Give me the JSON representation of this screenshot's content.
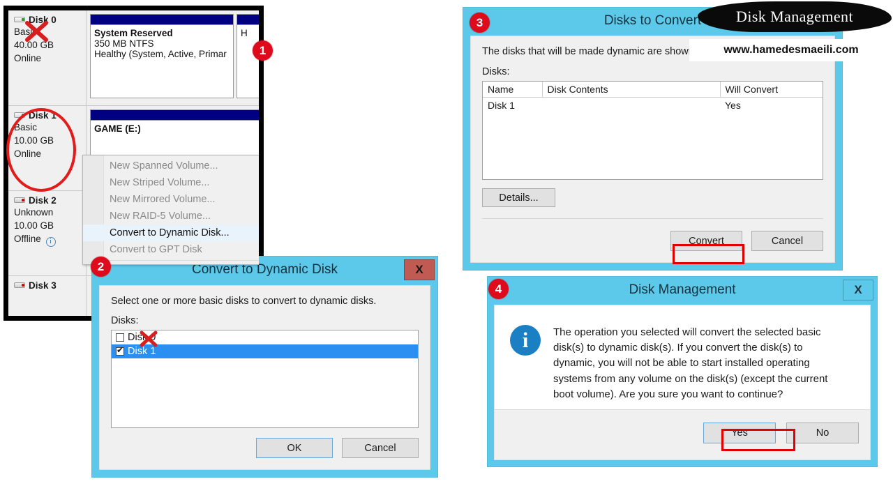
{
  "brand": {
    "banner_title": "Disk Management",
    "url": "www.hamedesmaeili.com"
  },
  "badges": {
    "one": "1",
    "two": "2",
    "three": "3",
    "four": "4"
  },
  "disk_management_console": {
    "disks": [
      {
        "name": "Disk 0",
        "type": "Basic",
        "size": "40.00 GB",
        "status": "Online",
        "icon": "hard-disk-icon",
        "volumes": [
          {
            "name": "System Reserved",
            "line1": "350 MB NTFS",
            "line2": "Healthy (System, Active, Primar"
          },
          {
            "name": "",
            "line1": "",
            "line2": "H"
          }
        ]
      },
      {
        "name": "Disk 1",
        "type": "Basic",
        "size": "10.00 GB",
        "status": "Online",
        "icon": "hard-disk-icon",
        "volumes": [
          {
            "name": "GAME  (E:)",
            "line1": "",
            "line2": ""
          }
        ]
      },
      {
        "name": "Disk 2",
        "type": "Unknown",
        "size": "10.00 GB",
        "status": "Offline",
        "status_icon": "info-icon",
        "icon": "offline-disk-icon",
        "volumes": []
      },
      {
        "name": "Disk 3",
        "type": "",
        "size": "",
        "status": "",
        "icon": "offline-disk-icon",
        "volumes": []
      }
    ],
    "context_menu": {
      "items": [
        {
          "label": "New Spanned Volume...",
          "enabled": false,
          "selected": false
        },
        {
          "label": "New Striped Volume...",
          "enabled": false,
          "selected": false
        },
        {
          "label": "New Mirrored Volume...",
          "enabled": false,
          "selected": false
        },
        {
          "label": "New RAID-5 Volume...",
          "enabled": false,
          "selected": false
        },
        {
          "label": "Convert to Dynamic Disk...",
          "enabled": true,
          "selected": true,
          "highlighted": true
        },
        {
          "label": "Convert to GPT Disk",
          "enabled": false,
          "selected": false
        }
      ]
    }
  },
  "convert_dialog": {
    "title": "Convert to Dynamic Disk",
    "close_label": "X",
    "instruction": "Select one or more basic disks to convert to dynamic disks.",
    "list_label": "Disks:",
    "disks": [
      {
        "label": "Disk 0",
        "checked": false,
        "selected": false
      },
      {
        "label": "Disk 1",
        "checked": true,
        "selected": true
      }
    ],
    "ok_label": "OK",
    "cancel_label": "Cancel"
  },
  "disks_to_convert_dialog": {
    "title": "Disks to Convert",
    "instruction": "The disks that will be made dynamic are shown in the foll",
    "list_label": "Disks:",
    "columns": [
      "Name",
      "Disk Contents",
      "Will Convert"
    ],
    "rows": [
      {
        "name": "Disk 1",
        "contents": "",
        "will_convert": "Yes"
      }
    ],
    "details_label": "Details...",
    "convert_label": "Convert",
    "cancel_label": "Cancel"
  },
  "confirm_dialog": {
    "title": "Disk Management",
    "close_label": "X",
    "icon": "info-icon",
    "message": "The operation you selected will convert the selected basic disk(s) to dynamic disk(s). If you convert the disk(s) to dynamic, you will not be able to start installed operating systems from any volume on the disk(s) (except the current boot volume). Are you sure you want to continue?",
    "yes_label": "Yes",
    "no_label": "No"
  },
  "colors": {
    "teal": "#5cc9ea",
    "accent_red": "#e00000",
    "badge_red": "#dd0b1b",
    "selection_blue": "#2a8ff0",
    "volume_bar_blue": "#000080"
  }
}
